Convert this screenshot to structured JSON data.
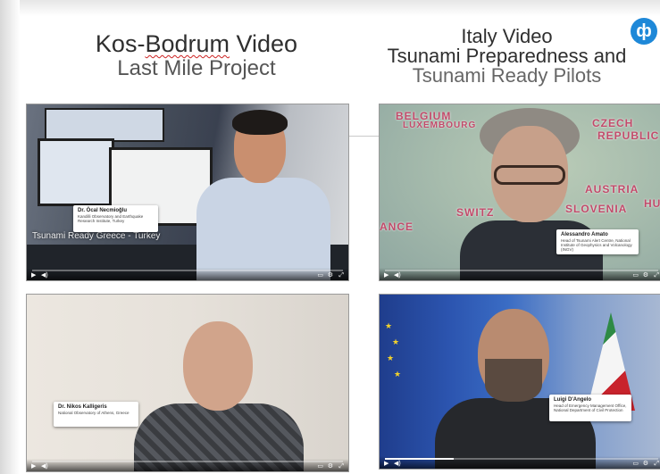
{
  "headings": {
    "left": {
      "line1_prefix": "Kos-",
      "line1_word": "Bodrum",
      "line1_suffix": " Video",
      "line2": "Last Mile Project"
    },
    "right": {
      "line1": "Italy Video",
      "line2": "Tsunami Preparedness and",
      "line3": "Tsunami Ready Pilots"
    }
  },
  "logo": {
    "icon": "ocean-organization-logo",
    "glyph": "ф",
    "color": "#1e88d8"
  },
  "videos": [
    {
      "id": "kos-bodrum-video-1",
      "caption": "Tsunami Ready Greece - Turkey",
      "speaker": {
        "name": "Dr. Öcal Necmioğlu",
        "desc": "Kandilli Observatory and Earthquake Research Institute, Turkey"
      },
      "progress": 0.0
    },
    {
      "id": "italy-video-1",
      "map_labels": [
        "BELGIUM",
        "LUXEMBOURG",
        "CZECH",
        "REPUBLIC",
        "AUSTRIA",
        "HUN",
        "SLOVENIA",
        "SWITZ",
        "ANCE"
      ],
      "speaker": {
        "name": "Alessandro Amato",
        "desc": "Head of Tsunami Alert Centre, National Institute of Geophysics and Volcanology (INGV)"
      },
      "progress": 0.0
    },
    {
      "id": "kos-bodrum-video-2",
      "speaker": {
        "name": "Dr. Nikos Kalligeris",
        "desc": "National Observatory of Athens, Greece"
      },
      "progress": 0.0
    },
    {
      "id": "italy-video-2",
      "speaker": {
        "name": "Luigi D'Angelo",
        "desc": "Head of Emergency Management Office, National Department of Civil Protection"
      },
      "progress": 0.25
    }
  ],
  "controls": {
    "play_icon": "play-icon",
    "volume_icon": "volume-icon",
    "cc_icon": "captions-icon",
    "settings_icon": "settings-icon",
    "fullscreen_icon": "fullscreen-icon"
  }
}
